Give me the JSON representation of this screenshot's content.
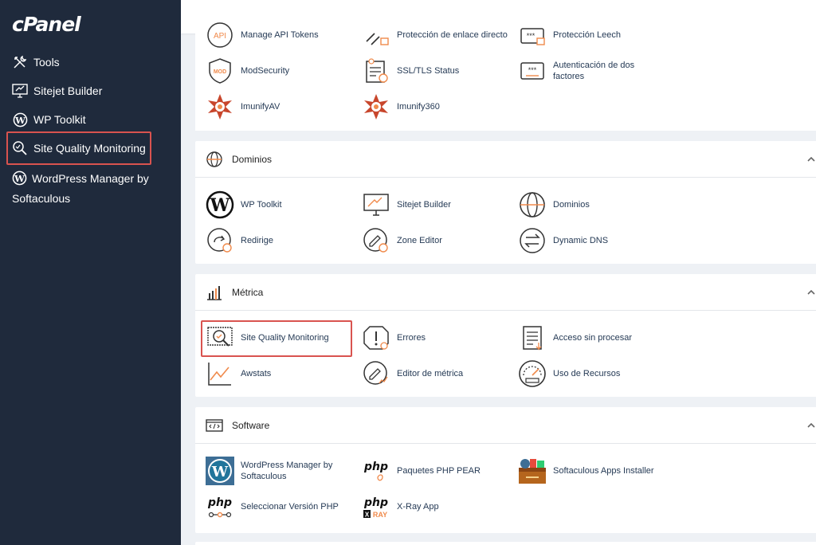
{
  "brand": {
    "logo_text": "cPanel"
  },
  "sidebar": {
    "items": [
      {
        "label": "Tools"
      },
      {
        "label": "Sitejet Builder"
      },
      {
        "label": "WP Toolkit"
      },
      {
        "label": "Site Quality Monitoring"
      },
      {
        "label": "WordPress Manager by Softaculous"
      }
    ]
  },
  "security_tools": [
    {
      "label": "Manage API Tokens"
    },
    {
      "label": "Protección de enlace directo"
    },
    {
      "label": "Protección Leech"
    },
    {
      "label": "ModSecurity"
    },
    {
      "label": "SSL/TLS Status"
    },
    {
      "label": "Autenticación de dos factores"
    },
    {
      "label": "ImunifyAV"
    },
    {
      "label": "Imunify360"
    }
  ],
  "sections": {
    "domains": {
      "title": "Dominios",
      "tools": [
        {
          "label": "WP Toolkit"
        },
        {
          "label": "Sitejet Builder"
        },
        {
          "label": "Dominios"
        },
        {
          "label": "Redirige"
        },
        {
          "label": "Zone Editor"
        },
        {
          "label": "Dynamic DNS"
        }
      ]
    },
    "metrics": {
      "title": "Métrica",
      "tools": [
        {
          "label": "Site Quality Monitoring"
        },
        {
          "label": "Errores"
        },
        {
          "label": "Acceso sin procesar"
        },
        {
          "label": "Awstats"
        },
        {
          "label": "Editor de métrica"
        },
        {
          "label": "Uso de Recursos"
        }
      ]
    },
    "software": {
      "title": "Software",
      "tools": [
        {
          "label": "WordPress Manager by Softaculous"
        },
        {
          "label": "Paquetes PHP PEAR"
        },
        {
          "label": "Softaculous Apps Installer"
        },
        {
          "label": "Seleccionar Versión PHP"
        },
        {
          "label": "X-Ray App"
        }
      ]
    }
  },
  "colors": {
    "sidebar_bg": "#1f2a3c",
    "highlight": "#d9534f",
    "link_text": "#253a55",
    "icon_accent": "#f08a4b"
  }
}
